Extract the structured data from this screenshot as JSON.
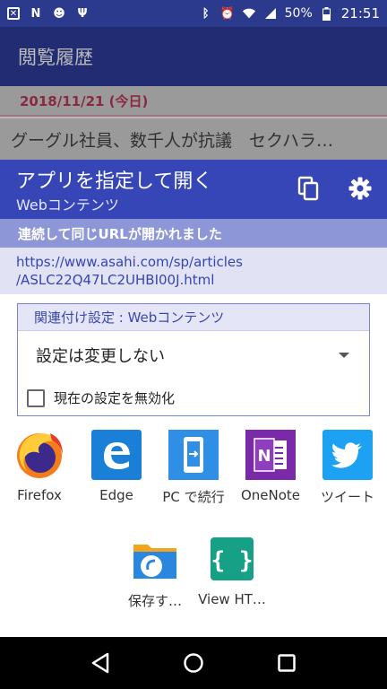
{
  "status_bar": {
    "battery": "50%",
    "time": "21:51",
    "left_icons": [
      "app-icon-x",
      "app-icon-n",
      "face-icon",
      "usb-icon"
    ],
    "right_icons": [
      "bluetooth-icon",
      "alarm-icon",
      "wifi-icon",
      "signal-icon",
      "battery-icon"
    ]
  },
  "background_app": {
    "title": "閲覧履歴",
    "date": "2018/11/21 (今日)",
    "headline": "グーグル社員、数千人が抗議　セクハラ…"
  },
  "dialog": {
    "title": "アプリを指定して開く",
    "subtitle": "Webコンテンツ",
    "copy_icon": "copy-icon",
    "settings_icon": "gear-icon",
    "notice": "連続して同じURLが開かれました",
    "url_line1": "https://www.asahi.com/sp/articles",
    "url_line2": "/ASLC22Q47LC2UHBI00J.html"
  },
  "association": {
    "label": "関連付け設定 : Webコンテンツ",
    "selected": "設定は変更しない",
    "checkbox_label": "現在の設定を無効化",
    "checkbox_checked": false
  },
  "apps": [
    {
      "label": "Firefox",
      "icon": "firefox-icon"
    },
    {
      "label": "Edge",
      "icon": "edge-icon"
    },
    {
      "label": "PC で続行",
      "icon": "continue-on-pc-icon"
    },
    {
      "label": "OneNote",
      "icon": "onenote-icon"
    },
    {
      "label": "ツイート",
      "icon": "twitter-icon"
    },
    {
      "label": "保存す…",
      "icon": "file-save-icon"
    },
    {
      "label": "View HT…",
      "icon": "view-html-icon"
    }
  ],
  "navigation": [
    "back-icon",
    "home-icon",
    "recents-icon"
  ],
  "colors": {
    "primary": "#3646b6",
    "status_bar": "#2b3a8c",
    "notice": "#8d96d6",
    "url_bg": "#e1e3f5"
  }
}
